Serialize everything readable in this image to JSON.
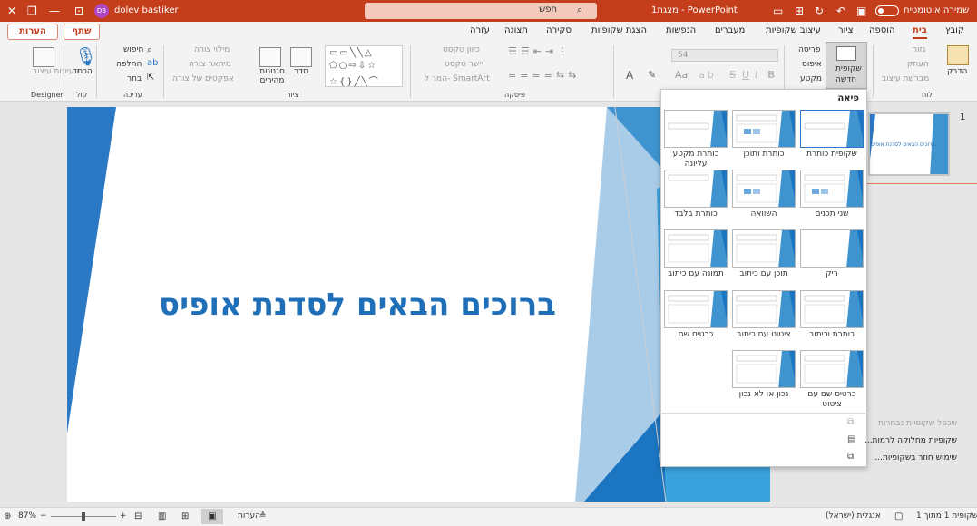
{
  "titlebar": {
    "autosave_label": "שמירה אוטומטית",
    "doc_title": "PowerPoint - מצגת1",
    "search_placeholder": "חפש",
    "user_name": "dolev bastiker",
    "user_initials": "DB"
  },
  "tabs": {
    "items": [
      "קובץ",
      "בית",
      "הוספה",
      "ציור",
      "עיצוב שקופיות",
      "מעברים",
      "הנפשות",
      "הצגת שקופיות",
      "סקירה",
      "תצוגה",
      "עזרה"
    ],
    "active": "בית",
    "share_label": "שתף",
    "comments_label": "הערות"
  },
  "ribbon": {
    "clipboard": {
      "paste": "הדבק",
      "cut": "גזור",
      "copy": "העתק",
      "format_painter": "מברשת עיצוב",
      "group": "לוח"
    },
    "slides": {
      "new_slide": "שקופית",
      "new_slide2": "חדשה",
      "layout": "פריסה",
      "reset": "איפוס",
      "section": "מקטע"
    },
    "font": {
      "size": "54",
      "bold": "B",
      "italic": "I",
      "underline": "U",
      "strike": "S",
      "font_color": "A",
      "grow": "Aa"
    },
    "paragraph": {
      "text_direction": "כיוון טקסט",
      "align_text": "יישר טקסט",
      "smartart": "המר ל- SmartArt",
      "group": "פיסקה"
    },
    "drawing": {
      "arrange": "סדר",
      "styles": "סגנונות מהירים",
      "shape_fill": "מילוי צורה",
      "shape_outline": "מיתאר צורה",
      "shape_effects": "אפקטים של צורה",
      "group": "ציור"
    },
    "editing": {
      "find": "חיפוש",
      "replace": "החלפה",
      "select": "בחר",
      "group": "עריכה"
    },
    "voice": {
      "dictate": "הכתב",
      "group": "קול"
    },
    "designer": {
      "ideas": "רעיונות עיצוב",
      "group": "Designer"
    }
  },
  "slide": {
    "title": "ברוכים הבאים לסדנת אופיס"
  },
  "thumbnail": {
    "number": "1",
    "text": "ברוכים הבאים לסדנת אופיס"
  },
  "gallery": {
    "header": "פיאה",
    "layouts": [
      {
        "label": "שקופית כותרת"
      },
      {
        "label": "כותרת ותוכן"
      },
      {
        "label": "כותרת מקטע עליונה"
      },
      {
        "label": "שני תכנים"
      },
      {
        "label": "השוואה"
      },
      {
        "label": "כותרת בלבד"
      },
      {
        "label": "ריק"
      },
      {
        "label": "תוכן עם כיתוב"
      },
      {
        "label": "תמונה עם כיתוב"
      },
      {
        "label": "כותרת וכיתוב"
      },
      {
        "label": "ציטוט עם כיתוב"
      },
      {
        "label": "כרטיס שם"
      },
      {
        "label": "כרטיס שם עם ציטוט"
      },
      {
        "label": "נכון או לא נכון"
      }
    ],
    "menu": {
      "duplicate": "שכפל שקופיות נבחרות",
      "outline": "שקופיות מחלוקה לרמות...",
      "reuse": "שימוש חוזר בשקופיות..."
    }
  },
  "statusbar": {
    "slide_info": "שקופית 1 מתוך 1",
    "language": "אנגלית (ישראל)",
    "notes": "הערות",
    "zoom": "87%"
  },
  "colors": {
    "accent": "#c43e1c",
    "title_blue": "#1f6fb8",
    "theme_blue": "#2b78c5"
  }
}
